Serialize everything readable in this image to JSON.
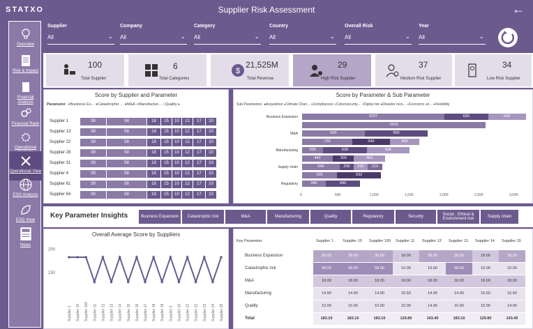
{
  "header": {
    "brand": "STATXO",
    "title": "Supplier Risk Assessment",
    "back_icon": "arrow-left-icon"
  },
  "sidebar": {
    "items": [
      {
        "label": "Overview",
        "icon": "lightbulb-icon"
      },
      {
        "label": "Risk & Impact",
        "icon": "document-icon"
      },
      {
        "label": "Financial Analysis",
        "icon": "file-icon"
      },
      {
        "label": "Financial Ratio",
        "icon": "gears-icon"
      },
      {
        "label": "Operational Analysis",
        "icon": "cogwheel-icon"
      },
      {
        "label": "Operational View",
        "icon": "tools-icon"
      },
      {
        "label": "ESG Analysis",
        "icon": "globe-icon"
      },
      {
        "label": "ESG View",
        "icon": "leaf-icon"
      },
      {
        "label": "News",
        "icon": "newspaper-icon"
      }
    ]
  },
  "filters": [
    {
      "label": "Supplier",
      "value": "All"
    },
    {
      "label": "Company",
      "value": "All"
    },
    {
      "label": "Category",
      "value": "All"
    },
    {
      "label": "Country",
      "value": "All"
    },
    {
      "label": "Overall Risk",
      "value": "All"
    },
    {
      "label": "Year",
      "value": "All"
    }
  ],
  "kpis": [
    {
      "value": "100",
      "label": "Total Supplier",
      "icon": "people-cart-icon"
    },
    {
      "value": "6",
      "label": "Total Categories",
      "icon": "grid-icon"
    },
    {
      "value": "21,525M",
      "label": "Total Revenue",
      "icon": "dollar-icon"
    },
    {
      "value": "29",
      "label": "High Risk Supplier",
      "icon": "user-danger-icon"
    },
    {
      "value": "37",
      "label": "Medium Risk Supplier",
      "icon": "user-search-icon"
    },
    {
      "value": "34",
      "label": "Low Risk Supplier",
      "icon": "user-badge-icon"
    }
  ],
  "score_by_supplier": {
    "title": "Score by Supplier and Parameter",
    "legend_title": "Parameter",
    "legend": [
      "Business Ex...",
      "Catastrophic ...",
      "M&A",
      "Manufacturi...",
      "Quality"
    ],
    "rows": [
      {
        "name": "Supplier 1",
        "values": [
          "39",
          "58",
          "18",
          "15",
          "10",
          "12",
          "17",
          "10"
        ]
      },
      {
        "name": "Supplier 13",
        "values": [
          "39",
          "58",
          "18",
          "15",
          "10",
          "12",
          "17",
          "10"
        ]
      },
      {
        "name": "Supplier 22",
        "values": [
          "39",
          "58",
          "18",
          "15",
          "10",
          "12",
          "17",
          "10"
        ]
      },
      {
        "name": "Supplier 28",
        "values": [
          "39",
          "58",
          "18",
          "15",
          "10",
          "12",
          "17",
          "10"
        ]
      },
      {
        "name": "Supplier 31",
        "values": [
          "39",
          "58",
          "18",
          "15",
          "10",
          "12",
          "17",
          "10"
        ]
      },
      {
        "name": "Supplier 4",
        "values": [
          "39",
          "58",
          "18",
          "15",
          "10",
          "12",
          "17",
          "10"
        ]
      },
      {
        "name": "Supplier 61",
        "values": [
          "39",
          "58",
          "18",
          "15",
          "10",
          "12",
          "17",
          "10"
        ]
      },
      {
        "name": "Supplier 64",
        "values": [
          "39",
          "58",
          "18",
          "15",
          "10",
          "12",
          "17",
          "10"
        ]
      }
    ]
  },
  "score_by_param": {
    "title": "Score by Parameter & Sub Parameter",
    "legend_title": "Sub-Parameters",
    "legend": [
      "Acquisition",
      "Climate Chan...",
      "Compliances",
      "Cybersecurity...",
      "Digital risk",
      "Disaster reco...",
      "Economic un...",
      "Flexibility"
    ],
    "categories": [
      "Business Expansion",
      "M&A",
      "Manufacturing",
      "Supply chain",
      "Regulatory"
    ],
    "rows": [
      {
        "cat": "Business Expansion",
        "segments": [
          "2037",
          "630",
          "540"
        ]
      },
      {
        "cat": "",
        "segments": [
          "2632"
        ]
      },
      {
        "cat": "M&A",
        "segments": [
          "900",
          "900"
        ]
      },
      {
        "cat": "",
        "segments": [
          "720",
          "540",
          "420"
        ]
      },
      {
        "cat": "Manufacturing",
        "segments": [
          "300",
          "630",
          "606"
        ]
      },
      {
        "cat": "",
        "segments": [
          "442",
          "300",
          "450"
        ]
      },
      {
        "cat": "Supply chain",
        "segments": [
          "540",
          "200",
          "200",
          "210"
        ]
      },
      {
        "cat": "",
        "segments": [
          "500",
          "632"
        ]
      },
      {
        "cat": "Regulatory",
        "segments": [
          "340",
          "490"
        ]
      }
    ],
    "x_ticks": [
      "0",
      "500",
      "1,000",
      "1,500",
      "2,000",
      "2,500",
      "3,000"
    ]
  },
  "insights": {
    "title": "Key Parameter Insights",
    "tabs": [
      "Business Expansion",
      "Catastrophic risk",
      "M&A",
      "Manufacturing",
      "Quality",
      "Regulatory",
      "Security",
      "Social , Ethical & Environment risk",
      "Supply chain"
    ]
  },
  "chart_data": {
    "type": "line",
    "title": "Overall Average Score by Suppliers",
    "xlabel": "",
    "ylabel": "",
    "ylim": [
      120,
      210
    ],
    "y_ticks": [
      "200",
      "150"
    ],
    "categories": [
      "Supplier 1",
      "Supplier 10",
      "Supplier 100",
      "Supplier 11",
      "Supplier 12",
      "Supplier 13",
      "Supplier 14",
      "Supplier 15",
      "Supplier 16",
      "Supplier 17",
      "Supplier 18",
      "Supplier 19",
      "Supplier 2",
      "Supplier 20",
      "Supplier 21",
      "Supplier 22",
      "Supplier 23",
      "Supplier 24",
      "Supplier 25"
    ],
    "values": [
      183,
      183,
      183,
      130,
      183,
      130,
      183,
      130,
      183,
      130,
      183,
      130,
      183,
      130,
      183,
      130,
      183,
      130,
      183
    ]
  },
  "key_table": {
    "header": [
      "Key Parameter",
      "Supplier 1",
      "Supplier 10",
      "Supplier 100",
      "Supplier 11",
      "Supplier 12",
      "Supplier 13",
      "Supplier 14",
      "Supplier 15"
    ],
    "rows": [
      {
        "name": "Business Expansion",
        "values": [
          "39.00",
          "39.00",
          "39.00",
          "18.00",
          "39.00",
          "39.00",
          "18.00",
          "39.00"
        ]
      },
      {
        "name": "Catastrophic risk",
        "values": [
          "58.00",
          "58.00",
          "58.00",
          "10.00",
          "10.00",
          "58.00",
          "10.00",
          "10.00"
        ]
      },
      {
        "name": "M&A",
        "values": [
          "18.00",
          "18.00",
          "18.00",
          "18.00",
          "18.00",
          "18.00",
          "18.00",
          "18.00"
        ]
      },
      {
        "name": "Manufacturing",
        "values": [
          "14.90",
          "14.90",
          "14.90",
          "15.60",
          "14.90",
          "14.90",
          "15.60",
          "15.60"
        ]
      },
      {
        "name": "Quality",
        "values": [
          "10.00",
          "10.00",
          "10.00",
          "10.00",
          "14.90",
          "10.00",
          "10.00",
          "14.00"
        ]
      }
    ],
    "total": {
      "name": "Total",
      "values": [
        "183.10",
        "183.10",
        "183.10",
        "129.80",
        "143.40",
        "183.10",
        "129.80",
        "143.40"
      ]
    }
  }
}
